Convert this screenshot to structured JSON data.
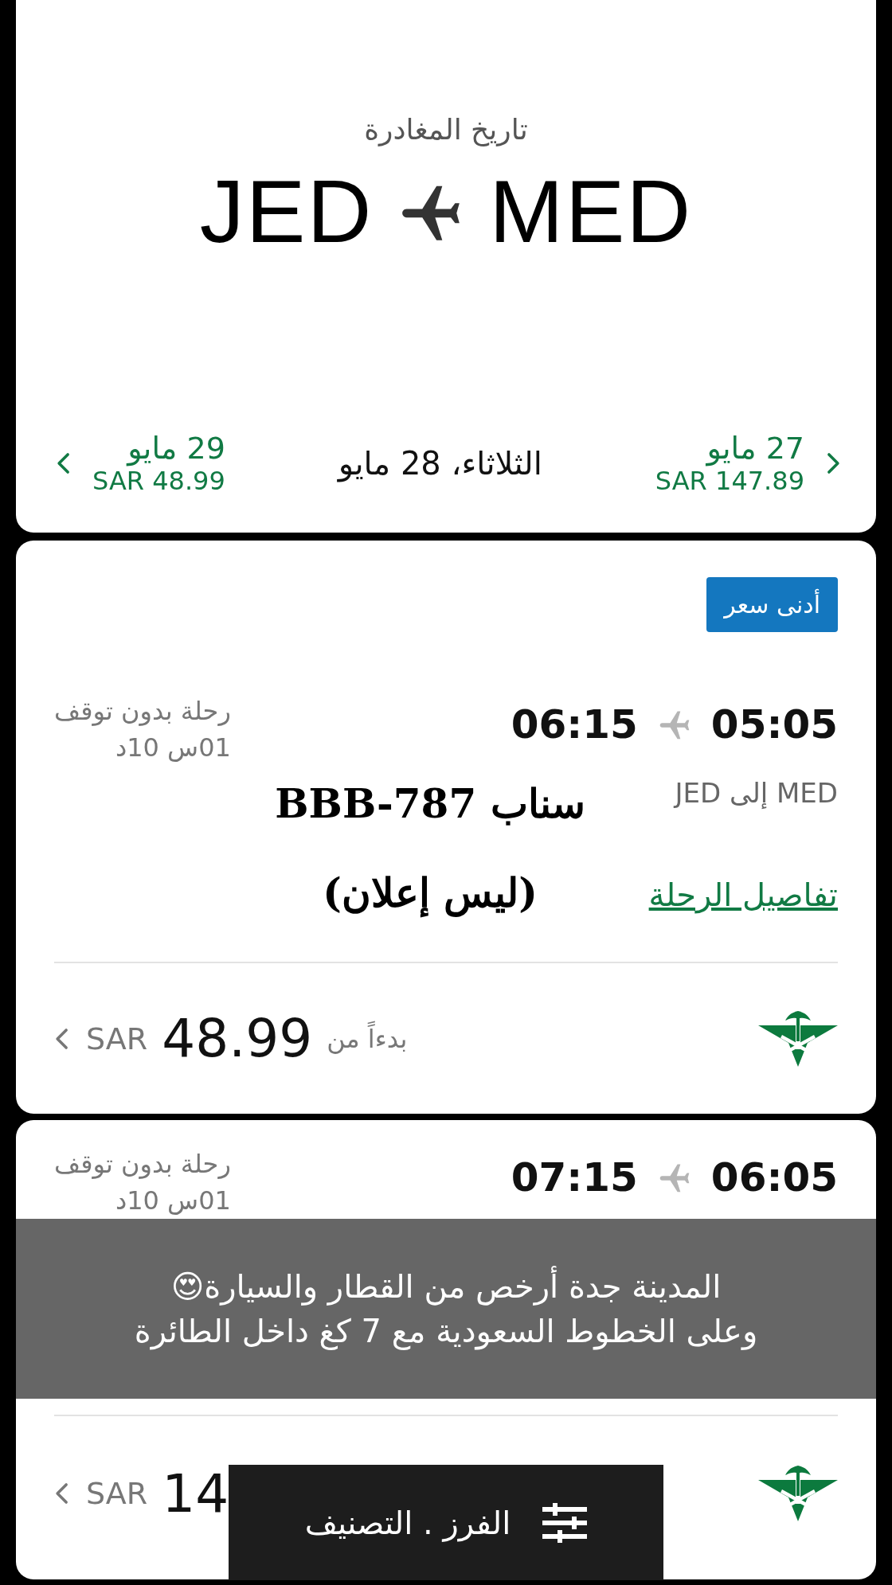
{
  "header": {
    "title": "تاريخ المغادرة",
    "origin": "JED",
    "destination": "MED"
  },
  "date_bar": {
    "later": {
      "date": "29 مايو",
      "price": "SAR 48.99"
    },
    "current": "الثلاثاء، 28 مايو",
    "earlier": {
      "date": "27 مايو",
      "price": "SAR 147.89"
    }
  },
  "flights": [
    {
      "badge": "أدنى سعر",
      "departure": "05:05",
      "arrival": "06:15",
      "stops": "رحلة بدون توقف",
      "duration": "01س 10د",
      "route": "MED إلى JED",
      "details_link": "تفاصيل الرحلة",
      "price_label": "بدءاً من",
      "price": "48.99",
      "currency": "SAR"
    },
    {
      "departure": "06:05",
      "arrival": "07:15",
      "stops": "رحلة بدون توقف",
      "duration": "01س 10د",
      "price": "14",
      "currency": "SAR"
    }
  ],
  "sticker_text": [
    "سناب BBB-787",
    "(ليس إعلان)"
  ],
  "caption": [
    "المدينة جدة أرخص من القطار والسيارة😍",
    "وعلى الخطوط السعودية مع 7 كغ داخل الطائرة"
  ],
  "sort_button": {
    "label": "الفرز . التصنيف"
  }
}
